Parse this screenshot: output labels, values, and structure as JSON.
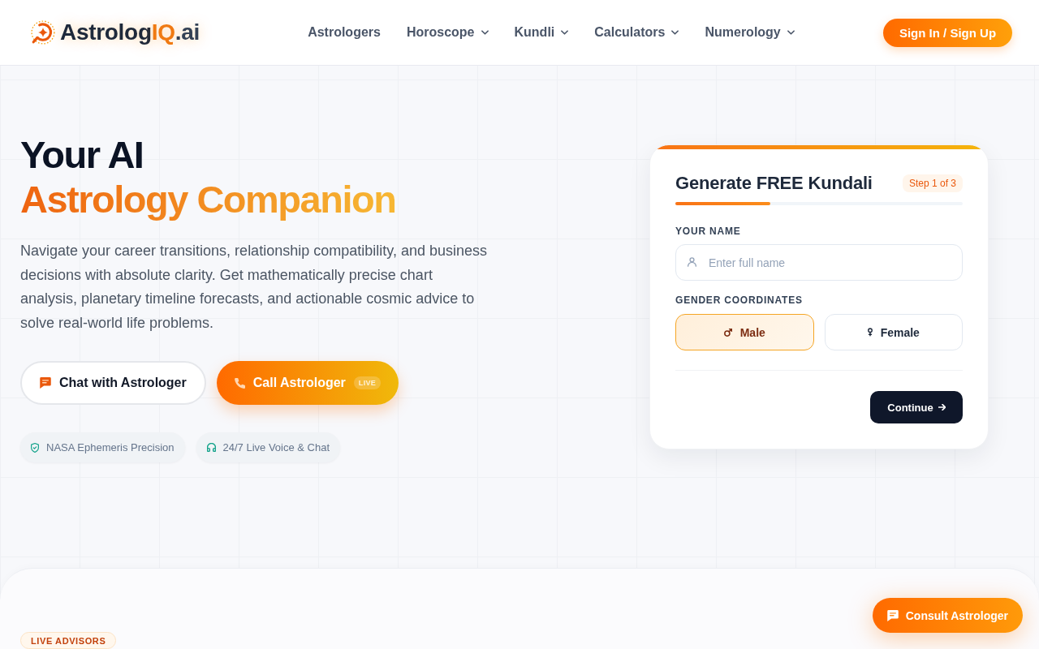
{
  "header": {
    "logo": {
      "parts": [
        {
          "text": "Astrolog",
          "kind": "base"
        },
        {
          "text": "IQ",
          "kind": "accent"
        },
        {
          "text": ".ai",
          "kind": "suffix"
        }
      ]
    },
    "nav": [
      {
        "label": "Astrologers",
        "dropdown": false
      },
      {
        "label": "Horoscope",
        "dropdown": true
      },
      {
        "label": "Kundli",
        "dropdown": true
      },
      {
        "label": "Calculators",
        "dropdown": true
      },
      {
        "label": "Numerology",
        "dropdown": true
      }
    ],
    "sign_in_button": {
      "label": "Sign In / Sign Up"
    }
  },
  "hero": {
    "heading": {
      "line_1": "Your AI",
      "line_2": "Astrology Companion"
    },
    "description": "Navigate your career transitions, relationship compatibility, and business decisions with absolute clarity. Get mathematically precise chart analysis, planetary timeline forecasts, and actionable cosmic advice to solve real-world life problems.",
    "buttons": [
      {
        "kind": "outline",
        "label": "Chat with Astrologer"
      },
      {
        "kind": "primary",
        "label": "Call Astrologer",
        "badge": "LIVE"
      }
    ],
    "features": [
      {
        "label": "NASA Ephemeris Precision"
      },
      {
        "label": "24/7 Live Voice & Chat"
      }
    ]
  },
  "kundali_form": {
    "title": "Generate FREE Kundali",
    "step": "Step 1 of 3",
    "progress": {
      "level": 0.33
    },
    "name_label": "YOUR NAME",
    "name_input": {
      "placeholder": "Enter full name"
    },
    "gender_label": "GENDER COORDINATES",
    "gender_options": [
      {
        "label": "Male",
        "selected": true
      },
      {
        "label": "Female",
        "selected": false
      }
    ],
    "continue_button": {
      "label": "Continue"
    }
  },
  "advisors_section": {
    "badge": "LIVE ADVISORS"
  },
  "floating_button": {
    "label": "Consult Astrologer"
  }
}
